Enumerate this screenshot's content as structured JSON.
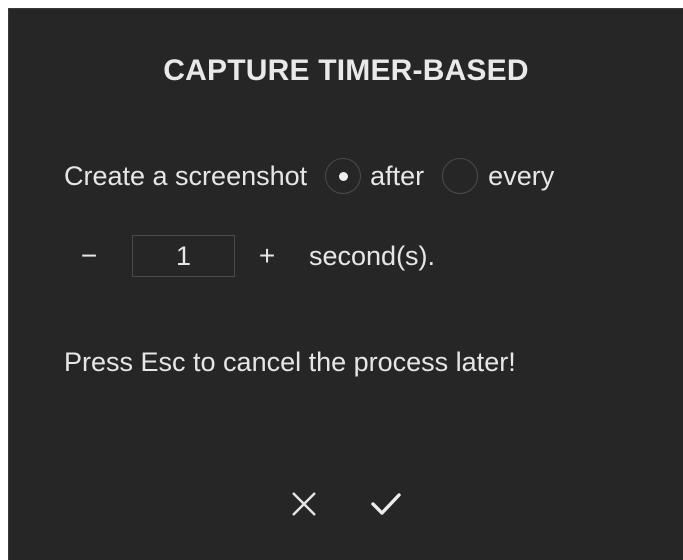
{
  "dialog": {
    "title": "CAPTURE TIMER-BASED",
    "prompt_label": "Create a screenshot",
    "mode_options": [
      {
        "label": "after",
        "selected": true
      },
      {
        "label": "every",
        "selected": false
      }
    ],
    "stepper": {
      "decrement_label": "−",
      "value": "1",
      "increment_label": "+",
      "unit_label": "second(s)."
    },
    "hint": "Press Esc to cancel the process later!",
    "actions": {
      "cancel_icon": "close-icon",
      "confirm_icon": "checkmark-icon"
    }
  },
  "colors": {
    "background": "#262626",
    "text": "#e6e6e6",
    "border": "#4a4a4a"
  }
}
